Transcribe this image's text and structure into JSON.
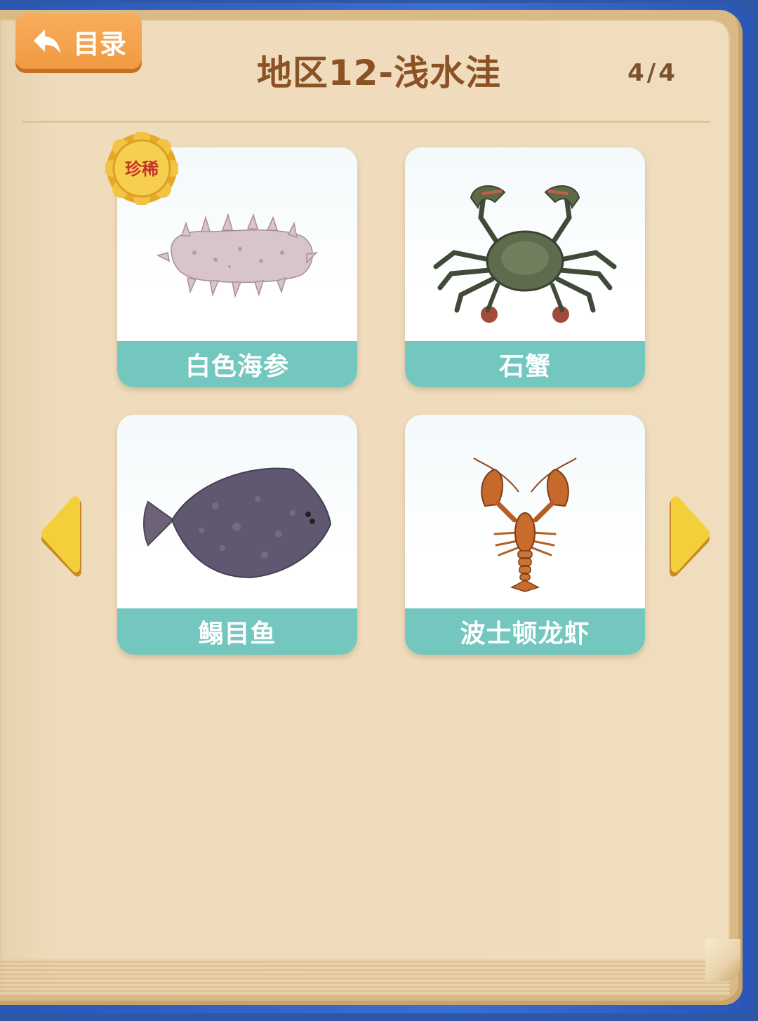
{
  "header": {
    "back_label": "目录",
    "title": "地区12-浅水洼",
    "page_indicator": "4/4"
  },
  "cards": [
    {
      "name": "白色海参",
      "rare": true,
      "rare_label": "珍稀",
      "icon": "sea-cucumber-icon"
    },
    {
      "name": "石蟹",
      "rare": false,
      "icon": "crab-icon"
    },
    {
      "name": "鳎目鱼",
      "rare": false,
      "icon": "flatfish-icon"
    },
    {
      "name": "波士顿龙虾",
      "rare": false,
      "icon": "lobster-icon"
    }
  ],
  "colors": {
    "label_bg": "#74c7bf",
    "title": "#8b5226",
    "back_button": "#f09a43",
    "arrow": "#f4cf3c"
  }
}
